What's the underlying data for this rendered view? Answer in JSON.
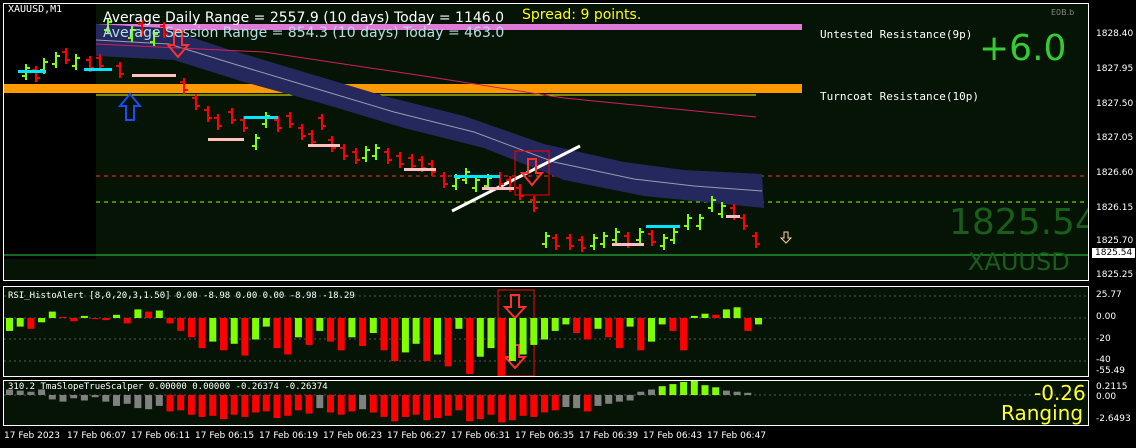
{
  "symbol": "XAUUSD,M1",
  "colors": {
    "bull": "#7fff00",
    "bear": "#ff0000",
    "background": "#061406",
    "resistance_untested": "#e07ad8",
    "resistance_turncoat": "#ff9900",
    "band": "#25285c"
  },
  "info": {
    "adr": "Average Daily Range = 2557.9 (10 days)   Today = 1146.0",
    "asr": "Average Session Range = 854.3 (10 days)   Today = 463.0",
    "spread": "Spread: 9 points.",
    "change": "+6.0",
    "price_big": "1825.54",
    "symbol_big": "XAUUSD",
    "corner_tag": "E0B.b"
  },
  "levels": {
    "untested": "Untested Resistance(9p)",
    "turncoat": "Turncoat Resistance(10p)"
  },
  "price_scale": {
    "ticks": [
      "1828.40",
      "1827.95",
      "1827.50",
      "1827.05",
      "1826.60",
      "1826.15",
      "1825.70",
      "1825.25"
    ],
    "current": "1825.54"
  },
  "rsi": {
    "title": "RSI_HistoAlert [8,0,20,3,1.50] 0.00 -8.98 0.00 0.00 -8.98 -18.29",
    "ticks": [
      "25.77",
      "0.00",
      "-20",
      "-40",
      "-55.49"
    ],
    "values": [
      -12,
      -8,
      -10,
      -4,
      6,
      1,
      -3,
      2,
      0,
      -2,
      3,
      -5,
      8,
      6,
      7,
      -5,
      -12,
      -18,
      -28,
      -22,
      -30,
      -24,
      -35,
      -20,
      -8,
      -28,
      -34,
      -18,
      -25,
      -12,
      -22,
      -30,
      -18,
      -26,
      -14,
      -30,
      -40,
      -32,
      -24,
      -40,
      -34,
      -45,
      -10,
      -52,
      -36,
      -28,
      -60,
      -40,
      -34,
      -25,
      -20,
      -12,
      -6,
      -14,
      -20,
      -10,
      -18,
      -28,
      -8,
      -30,
      -22,
      -6,
      -12,
      -30,
      2,
      4,
      3,
      8,
      10,
      -12,
      -6
    ]
  },
  "tma": {
    "title": "310.2 TmaSlopeTrueScalper 0.00000 0.00000 -0.26374 -0.26374",
    "ticks": [
      "0.2115",
      "0.00",
      "-2.6493"
    ],
    "slope": "-0.26",
    "state": "Ranging",
    "values": [
      0.5,
      0.4,
      0.3,
      0.5,
      -0.4,
      -0.6,
      -0.3,
      -0.5,
      -0.2,
      -0.6,
      -1.0,
      -0.8,
      -1.2,
      -1.3,
      -1.0,
      -1.5,
      -1.4,
      -1.8,
      -2.0,
      -1.9,
      -2.2,
      -1.8,
      -2.0,
      -1.6,
      -1.5,
      -2.1,
      -1.9,
      -1.4,
      -1.7,
      -1.2,
      -1.6,
      -1.8,
      -1.5,
      -1.3,
      -1.6,
      -2.0,
      -2.4,
      -2.0,
      -1.8,
      -2.3,
      -2.1,
      -1.9,
      -1.4,
      -2.4,
      -2.2,
      -1.8,
      -2.5,
      -2.3,
      -1.9,
      -2.0,
      -1.6,
      -1.4,
      -1.1,
      -1.2,
      -1.5,
      -1.0,
      -0.8,
      -0.6,
      -0.5,
      0.3,
      0.5,
      0.8,
      1.0,
      1.2,
      1.4,
      0.9,
      0.7,
      0.4,
      0.3,
      0.2
    ]
  },
  "time_axis": [
    "17 Feb 2023",
    "17 Feb 06:07",
    "17 Feb 06:11",
    "17 Feb 06:15",
    "17 Feb 06:19",
    "17 Feb 06:23",
    "17 Feb 06:27",
    "17 Feb 06:31",
    "17 Feb 06:35",
    "17 Feb 06:39",
    "17 Feb 06:43",
    "17 Feb 06:47"
  ]
}
